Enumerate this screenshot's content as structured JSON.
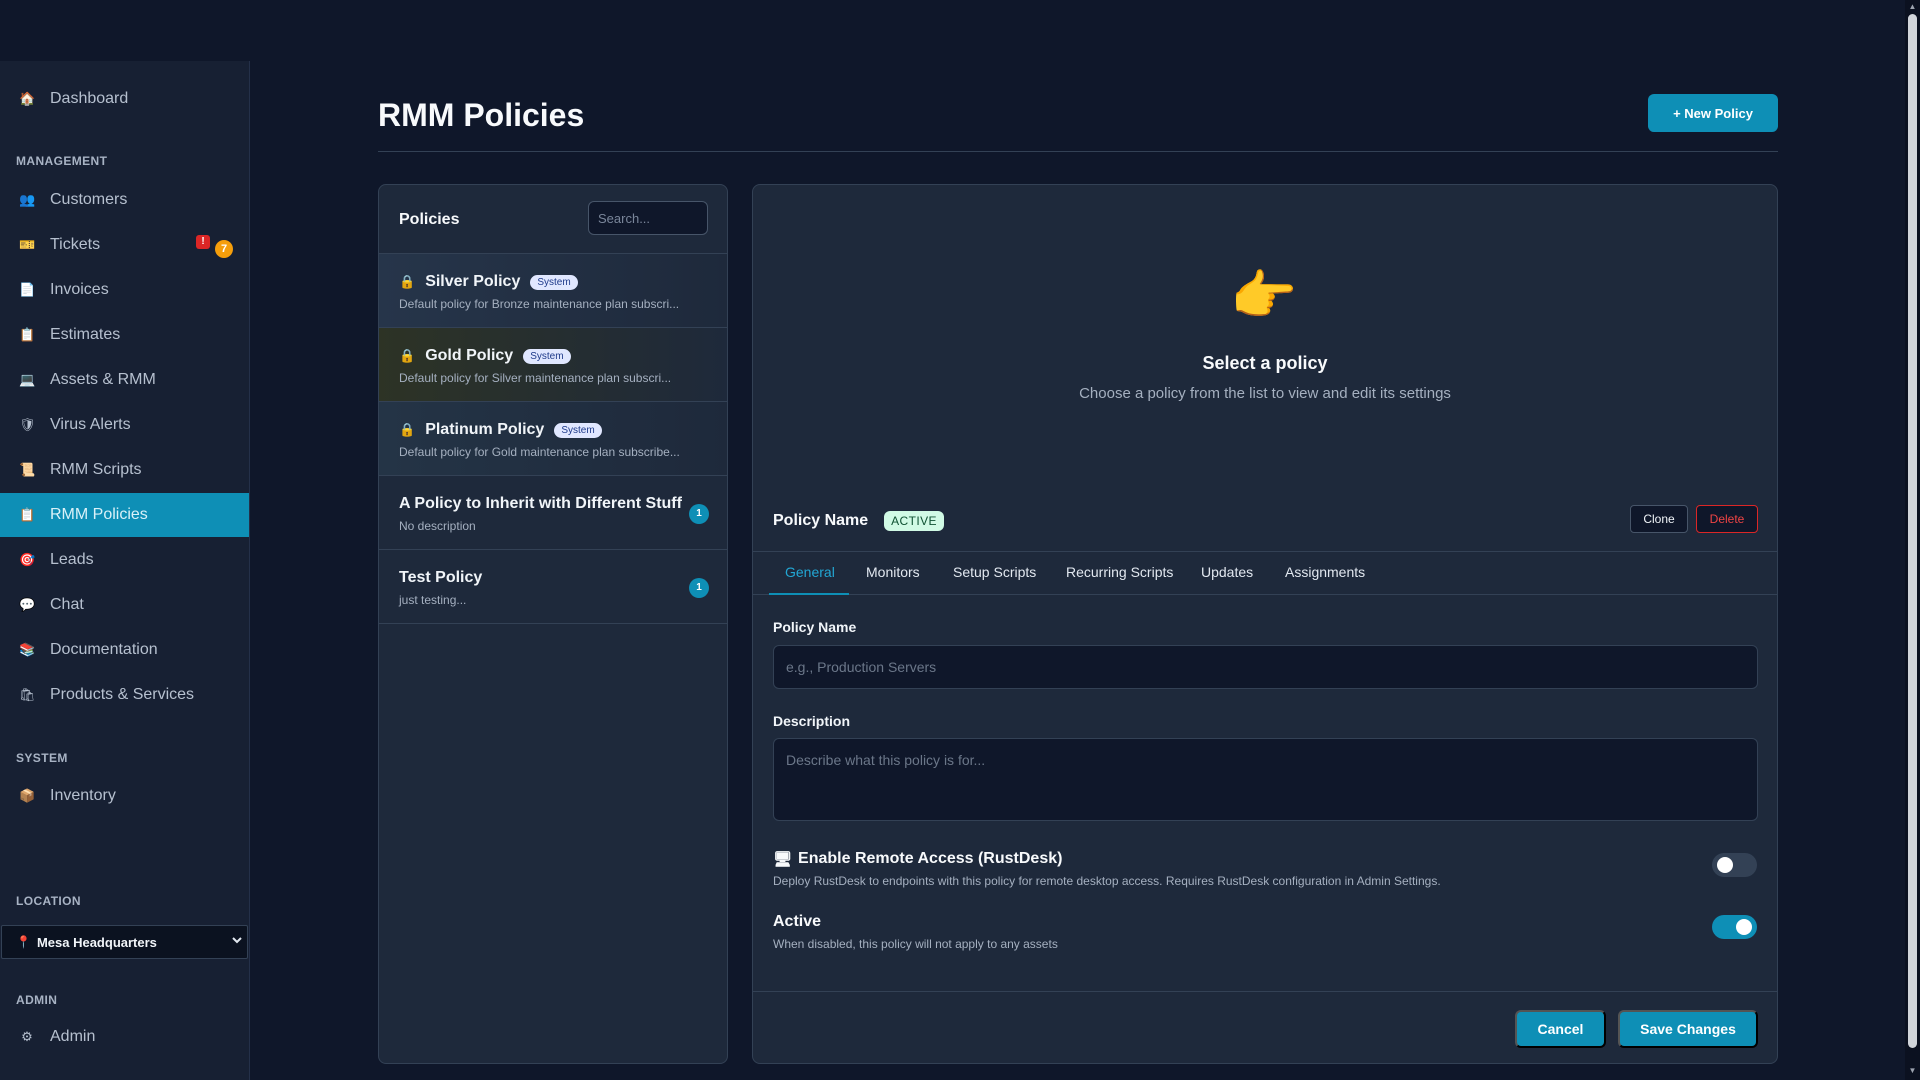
{
  "sidebar": {
    "items": {
      "dashboard": {
        "label": "Dashboard",
        "icon": "house-icon",
        "glyph": "🏠"
      },
      "customers": {
        "label": "Customers",
        "icon": "users-icon",
        "glyph": "👥"
      },
      "tickets": {
        "label": "Tickets",
        "icon": "ticket-icon",
        "glyph": "🎫",
        "alert": "!",
        "count": "7"
      },
      "invoices": {
        "label": "Invoices",
        "icon": "document-icon",
        "glyph": "📄"
      },
      "estimates": {
        "label": "Estimates",
        "icon": "clipboard-icon",
        "glyph": "📋"
      },
      "assets": {
        "label": "Assets & RMM",
        "icon": "laptop-icon",
        "glyph": "💻"
      },
      "virus": {
        "label": "Virus Alerts",
        "icon": "shield-icon",
        "glyph": "🛡"
      },
      "rmm_scripts": {
        "label": "RMM Scripts",
        "icon": "scroll-icon",
        "glyph": "📜"
      },
      "rmm_policies": {
        "label": "RMM Policies",
        "icon": "clipboard-icon",
        "glyph": "📋"
      },
      "leads": {
        "label": "Leads",
        "icon": "target-icon",
        "glyph": "🎯"
      },
      "chat": {
        "label": "Chat",
        "icon": "chat-bubble-icon",
        "glyph": "💬"
      },
      "documentation": {
        "label": "Documentation",
        "icon": "books-icon",
        "glyph": "📚"
      },
      "products": {
        "label": "Products & Services",
        "icon": "shopping-bags-icon",
        "glyph": "🛍"
      },
      "inventory": {
        "label": "Inventory",
        "icon": "package-icon",
        "glyph": "📦"
      },
      "admin": {
        "label": "Admin",
        "icon": "gear-icon",
        "glyph": "⚙"
      }
    },
    "sections": {
      "management": "MANAGEMENT",
      "system": "SYSTEM",
      "location": "LOCATION",
      "admin": "ADMIN"
    },
    "location": {
      "selected": "Mesa Headquarters",
      "pin": "📍",
      "chevron": "⌄"
    }
  },
  "header": {
    "title": "RMM Policies",
    "new_button": "+ New Policy"
  },
  "policies": {
    "title": "Policies",
    "search_placeholder": "Search...",
    "items": [
      {
        "name": "Silver Policy",
        "badge": "System",
        "description": "Default policy for Bronze maintenance plan subscri...",
        "locked": true
      },
      {
        "name": "Gold Policy",
        "badge": "System",
        "description": "Default policy for Silver maintenance plan subscri...",
        "locked": true
      },
      {
        "name": "Platinum Policy",
        "badge": "System",
        "description": "Default policy for Gold maintenance plan subscribe...",
        "locked": true
      },
      {
        "name": "A Policy to Inherit with Different Stuff",
        "description": "No description",
        "count": "1"
      },
      {
        "name": "Test Policy",
        "description": "just testing...",
        "count": "1"
      }
    ],
    "lock_glyph": "🔒"
  },
  "detail": {
    "empty_icon": "👉",
    "empty_title": "Select a policy",
    "empty_subtitle": "Choose a policy from the list to view and edit its settings",
    "heading": "Policy Name",
    "status": "ACTIVE",
    "clone": "Clone",
    "delete": "Delete",
    "tabs": [
      "General",
      "Monitors",
      "Setup Scripts",
      "Recurring Scripts",
      "Updates",
      "Assignments"
    ],
    "active_tab": "General",
    "fields": {
      "name_label": "Policy Name",
      "name_value": "",
      "name_placeholder": "e.g., Production Servers",
      "description_label": "Description",
      "description_value": "",
      "description_placeholder": "Describe what this policy is for..."
    },
    "remote": {
      "icon": "🖥",
      "title": "Enable Remote Access (RustDesk)",
      "description": "Deploy RustDesk to endpoints with this policy for remote desktop access. Requires RustDesk configuration in Admin Settings.",
      "enabled": false
    },
    "active": {
      "title": "Active",
      "description": "When disabled, this policy will not apply to any assets",
      "enabled": true
    },
    "cancel": "Cancel",
    "save": "Save Changes"
  },
  "colors": {
    "accent": "#0e8fb6",
    "background": "#0f172a",
    "panel": "#1e293b",
    "danger": "#dc2626",
    "warning": "#f59e0b"
  }
}
